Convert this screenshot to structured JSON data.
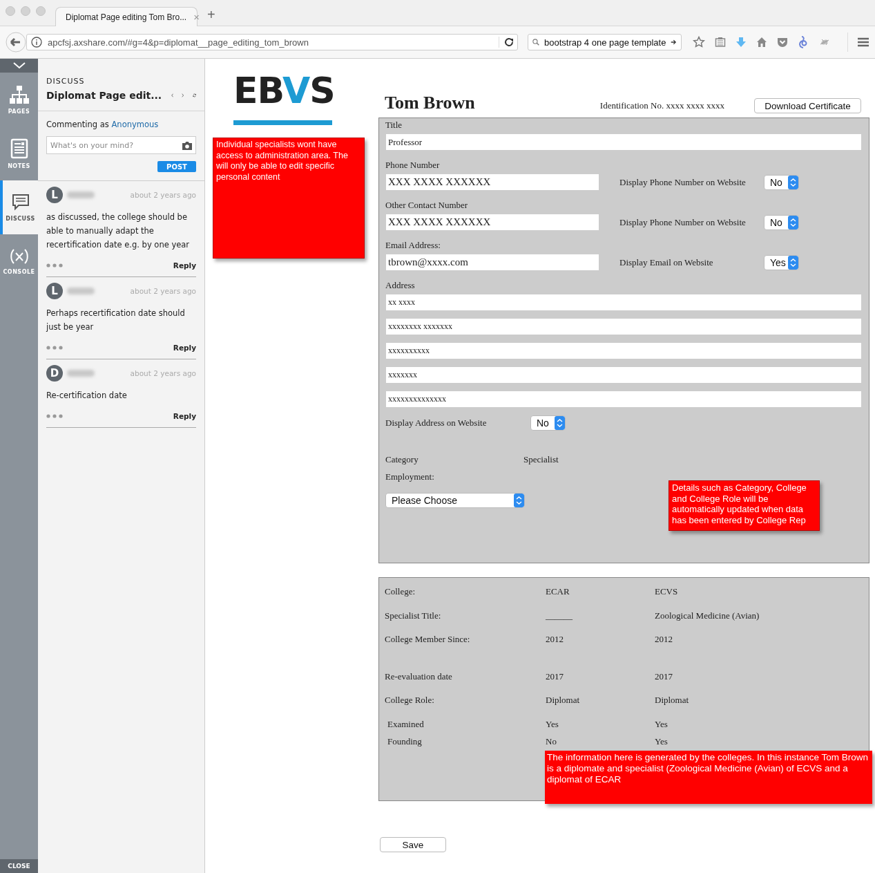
{
  "browser": {
    "tab_title": "Diplomat Page editing Tom Bro...",
    "tab_close": "×",
    "new_tab": "+",
    "url": "apcfsj.axshare.com/#g=4&p=diplomat__page_editing_tom_brown",
    "search": "bootstrap 4 one page template"
  },
  "rail": {
    "items": [
      {
        "kind": "pages",
        "label": "PAGES",
        "selected": false
      },
      {
        "kind": "notes",
        "label": "NOTES",
        "selected": false
      },
      {
        "kind": "discuss",
        "label": "DISCUSS",
        "selected": true
      },
      {
        "kind": "console",
        "label": "CONSOLE",
        "selected": false
      }
    ],
    "close": "CLOSE"
  },
  "discuss": {
    "heading": "DISCUSS",
    "title": "Diplomat Page edit...",
    "commenting_as": "Commenting as",
    "user": "Anonymous",
    "placeholder": "What's on your mind?",
    "post": "POST",
    "comments": [
      {
        "initial": "L",
        "time": "about 2 years ago",
        "text": "as discussed, the college should be able to manually adapt the recertification date e.g. by one year",
        "reply": "Reply"
      },
      {
        "initial": "L",
        "time": "about 2 years ago",
        "text": "Perhaps recertification date should just be year",
        "reply": "Reply"
      },
      {
        "initial": "D",
        "time": "about 2 years ago",
        "text": "Re-certification date",
        "reply": "Reply"
      }
    ]
  },
  "logo": [
    {
      "text": "EB",
      "accent": false
    },
    {
      "text": "V",
      "accent": true
    },
    {
      "text": "S",
      "accent": false
    }
  ],
  "notes": [
    "Individual specialists wont have access to administration area. The will only be able to edit specific personal content",
    "Details such as Category, College and College Role will be automatically updated when data has been entered by College Rep",
    "The information here is generated by the colleges.  In this instance Tom Brown is a diplomate and specialist (Zoological Medicine (Avian) of  ECVS and a diplomat of  ECAR"
  ],
  "profile": {
    "name": "Tom Brown",
    "identification": "Identification No. xxxx xxxx xxxx",
    "download": "Download Certificate"
  },
  "form": {
    "fields": [
      {
        "kind": "full",
        "label": "Title",
        "value": "Professor"
      },
      {
        "kind": "toggle",
        "label": "Phone Number",
        "value": "XXX XXXX XXXXXX",
        "toggle_label": "Display Phone Number on Website",
        "toggle_value": "No"
      },
      {
        "kind": "toggle",
        "label": "Other Contact Number",
        "value": "XXX XXXX XXXXXX",
        "toggle_label": "Display Phone Number on Website",
        "toggle_value": "No"
      },
      {
        "kind": "toggle",
        "label": "Email Address:",
        "value": "tbrown@xxxx.com",
        "toggle_label": "Display Email on Website",
        "toggle_value": "Yes"
      }
    ],
    "address_label": "Address",
    "address_lines": [
      "xx  xxxx",
      "xxxxxxxx xxxxxxx",
      "xxxxxxxxxx",
      "xxxxxxx",
      "xxxxxxxxxxxxxx"
    ],
    "display_address_label": "Display Address on Website",
    "display_address_value": "No",
    "category_label": "Category",
    "category_value": "Specialist",
    "employment_label": "Employment:",
    "employment_value": "Please Choose"
  },
  "colleges": [
    {
      "label": "College:",
      "col1": "ECAR",
      "col2": "ECVS"
    },
    {
      "label": "Specialist Title:",
      "col1": "______",
      "col2": "Zoological Medicine (Avian)"
    },
    {
      "label": "College Member Since:",
      "col1": "2012",
      "col2": "2012"
    },
    {
      "label": "Re-evaluation date",
      "col1": "2017",
      "col2": "2017"
    },
    {
      "label": "College Role:",
      "col1": "Diplomat",
      "col2": "Diplomat"
    },
    {
      "label": "Examined",
      "col1": "Yes",
      "col2": "Yes"
    },
    {
      "label": "Founding",
      "col1": "No",
      "col2": "Yes"
    }
  ],
  "save": "Save"
}
